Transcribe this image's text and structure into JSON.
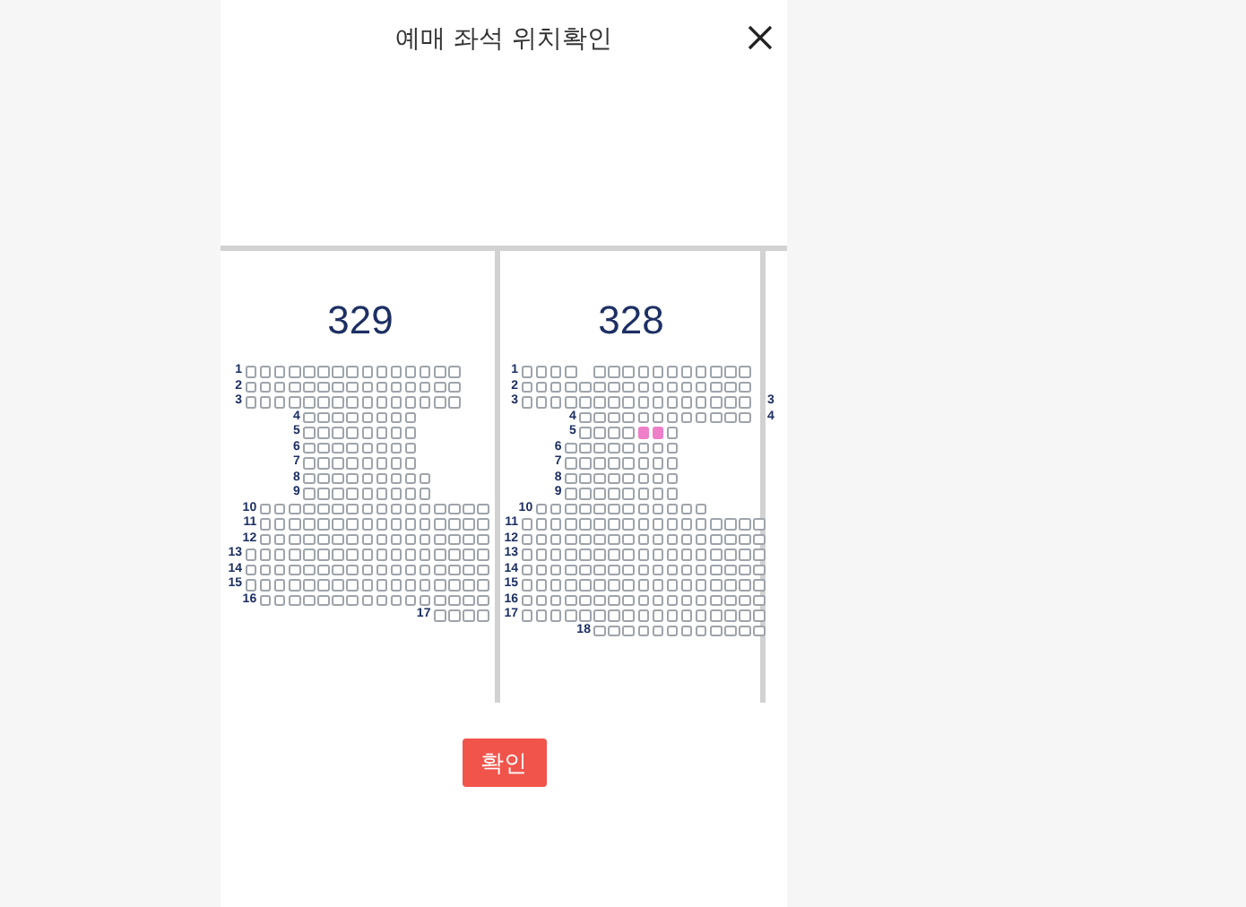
{
  "title": "예매 좌석 위치확인",
  "sections": [
    {
      "title": "329",
      "rows": [
        {
          "label": "1",
          "seats": [
            false,
            false,
            false,
            false,
            false,
            false,
            false,
            false,
            false,
            false,
            false,
            false,
            false,
            false,
            false
          ]
        },
        {
          "label": "2",
          "seats": [
            false,
            false,
            false,
            false,
            false,
            false,
            false,
            false,
            false,
            false,
            false,
            false,
            false,
            false,
            false
          ]
        },
        {
          "label": "3",
          "seats": [
            false,
            false,
            false,
            false,
            false,
            false,
            false,
            false,
            false,
            false,
            false,
            false,
            false,
            false,
            false
          ]
        },
        {
          "label": "4",
          "seats": [
            false,
            false,
            false,
            false,
            false,
            false,
            false,
            false
          ]
        },
        {
          "label": "5",
          "seats": [
            false,
            false,
            false,
            false,
            false,
            false,
            false,
            false
          ]
        },
        {
          "label": "6",
          "seats": [
            false,
            false,
            false,
            false,
            false,
            false,
            false,
            false
          ]
        },
        {
          "label": "7",
          "seats": [
            false,
            false,
            false,
            false,
            false,
            false,
            false,
            false
          ]
        },
        {
          "label": "8",
          "seats": [
            false,
            false,
            false,
            false,
            false,
            false,
            false,
            false,
            false
          ]
        },
        {
          "label": "9",
          "seats": [
            false,
            false,
            false,
            false,
            false,
            false,
            false,
            false,
            false
          ]
        },
        {
          "label": "10",
          "seats": [
            false,
            false,
            false,
            false,
            false,
            false,
            false,
            false,
            false,
            false,
            false,
            false,
            false,
            false,
            false,
            false
          ]
        },
        {
          "label": "11",
          "seats": [
            false,
            false,
            false,
            false,
            false,
            false,
            false,
            false,
            false,
            false,
            false,
            false,
            false,
            false,
            false,
            false
          ]
        },
        {
          "label": "12",
          "seats": [
            false,
            false,
            false,
            false,
            false,
            false,
            false,
            false,
            false,
            false,
            false,
            false,
            false,
            false,
            false,
            false
          ]
        },
        {
          "label": "13",
          "seats": [
            false,
            false,
            false,
            false,
            false,
            false,
            false,
            false,
            false,
            false,
            false,
            false,
            false,
            false,
            false,
            false,
            false
          ]
        },
        {
          "label": "14",
          "seats": [
            false,
            false,
            false,
            false,
            false,
            false,
            false,
            false,
            false,
            false,
            false,
            false,
            false,
            false,
            false,
            false,
            false
          ]
        },
        {
          "label": "15",
          "seats": [
            false,
            false,
            false,
            false,
            false,
            false,
            false,
            false,
            false,
            false,
            false,
            false,
            false,
            false,
            false,
            false,
            false
          ]
        },
        {
          "label": "16",
          "seats": [
            false,
            false,
            false,
            false,
            false,
            false,
            false,
            false,
            false,
            false,
            false,
            false,
            false,
            false,
            false,
            false
          ]
        },
        {
          "label": "17",
          "seats": [
            false,
            false,
            false,
            false
          ]
        }
      ]
    },
    {
      "title": "328",
      "rows": [
        {
          "label": "1",
          "seats": [
            false,
            false,
            false,
            false,
            false,
            false,
            false,
            false,
            false,
            false,
            false,
            false,
            false,
            false,
            false
          ]
        },
        {
          "label": "2",
          "seats": [
            false,
            false,
            false,
            false,
            false,
            false,
            false,
            false,
            false,
            false,
            false,
            false,
            false,
            false,
            false,
            false
          ]
        },
        {
          "label": "3",
          "seats": [
            false,
            false,
            false,
            false,
            false,
            false,
            false,
            false,
            false,
            false,
            false,
            false,
            false,
            false,
            false,
            false
          ]
        },
        {
          "label": "4",
          "seats": [
            false,
            false,
            false,
            false,
            false,
            false,
            false,
            false,
            false,
            false,
            false,
            false
          ]
        },
        {
          "label": "5",
          "seats": [
            false,
            false,
            false,
            false,
            true,
            true,
            false
          ]
        },
        {
          "label": "6",
          "seats": [
            false,
            false,
            false,
            false,
            false,
            false,
            false,
            false
          ]
        },
        {
          "label": "7",
          "seats": [
            false,
            false,
            false,
            false,
            false,
            false,
            false,
            false
          ]
        },
        {
          "label": "8",
          "seats": [
            false,
            false,
            false,
            false,
            false,
            false,
            false,
            false
          ]
        },
        {
          "label": "9",
          "seats": [
            false,
            false,
            false,
            false,
            false,
            false,
            false,
            false
          ]
        },
        {
          "label": "10",
          "seats": [
            false,
            false,
            false,
            false,
            false,
            false,
            false,
            false,
            false,
            false,
            false,
            false
          ]
        },
        {
          "label": "11",
          "seats": [
            false,
            false,
            false,
            false,
            false,
            false,
            false,
            false,
            false,
            false,
            false,
            false,
            false,
            false,
            false,
            false,
            false
          ]
        },
        {
          "label": "12",
          "seats": [
            false,
            false,
            false,
            false,
            false,
            false,
            false,
            false,
            false,
            false,
            false,
            false,
            false,
            false,
            false,
            false,
            false
          ]
        },
        {
          "label": "13",
          "seats": [
            false,
            false,
            false,
            false,
            false,
            false,
            false,
            false,
            false,
            false,
            false,
            false,
            false,
            false,
            false,
            false,
            false
          ]
        },
        {
          "label": "14",
          "seats": [
            false,
            false,
            false,
            false,
            false,
            false,
            false,
            false,
            false,
            false,
            false,
            false,
            false,
            false,
            false,
            false,
            false
          ]
        },
        {
          "label": "15",
          "seats": [
            false,
            false,
            false,
            false,
            false,
            false,
            false,
            false,
            false,
            false,
            false,
            false,
            false,
            false,
            false,
            false,
            false
          ]
        },
        {
          "label": "16",
          "seats": [
            false,
            false,
            false,
            false,
            false,
            false,
            false,
            false,
            false,
            false,
            false,
            false,
            false,
            false,
            false,
            false,
            false
          ]
        },
        {
          "label": "17",
          "seats": [
            false,
            false,
            false,
            false,
            false,
            false,
            false,
            false,
            false,
            false,
            false,
            false,
            false,
            false,
            false,
            false,
            false
          ]
        },
        {
          "label": "18",
          "seats": [
            false,
            false,
            false,
            false,
            false,
            false,
            false,
            false,
            false,
            false,
            false,
            false
          ]
        }
      ]
    },
    {
      "rows": [
        {
          "label": "3"
        },
        {
          "label": "4"
        }
      ]
    }
  ],
  "confirm_button": "확인"
}
